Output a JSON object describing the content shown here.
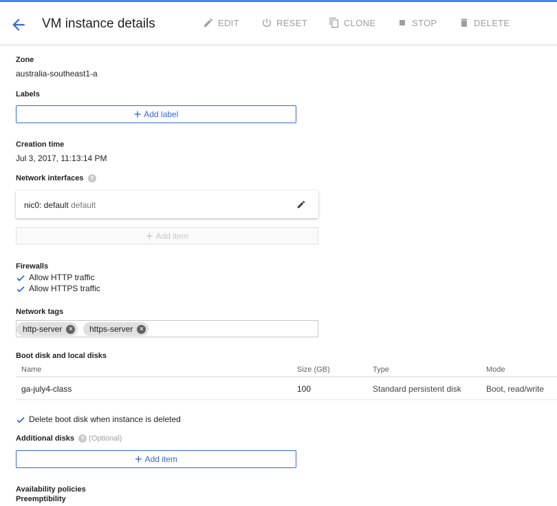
{
  "header": {
    "title": "VM instance details",
    "actions": {
      "edit": "EDIT",
      "reset": "RESET",
      "clone": "CLONE",
      "stop": "STOP",
      "delete": "DELETE"
    }
  },
  "zone": {
    "label": "Zone",
    "value": "australia-southeast1-a"
  },
  "labels": {
    "label": "Labels",
    "add_button": "Add label"
  },
  "creation_time": {
    "label": "Creation time",
    "value": "Jul 3, 2017, 11:13:14 PM"
  },
  "network_interfaces": {
    "label": "Network interfaces",
    "items": [
      {
        "name": "nic0: default",
        "network": "default"
      }
    ],
    "add_item": "Add item"
  },
  "firewalls": {
    "label": "Firewalls",
    "options": [
      {
        "label": "Allow HTTP traffic",
        "checked": true
      },
      {
        "label": "Allow HTTPS traffic",
        "checked": true
      }
    ]
  },
  "network_tags": {
    "label": "Network tags",
    "tags": [
      "http-server",
      "https-server"
    ]
  },
  "boot_disk": {
    "label": "Boot disk and local disks",
    "columns": [
      "Name",
      "Size (GB)",
      "Type",
      "Mode"
    ],
    "rows": [
      {
        "name": "ga-july4-class",
        "size": "100",
        "type": "Standard persistent disk",
        "mode": "Boot, read/write"
      }
    ],
    "delete_on_instance_delete": {
      "label": "Delete boot disk when instance is deleted",
      "checked": true
    }
  },
  "additional_disks": {
    "label": "Additional disks",
    "optional": "(Optional)",
    "add_button": "Add item"
  },
  "availability_policies": {
    "label": "Availability policies",
    "preemptibility_label": "Preemptibility"
  },
  "colors": {
    "accent": "#3367d6",
    "topbar": "#4285f4",
    "disabled": "#9e9e9e"
  }
}
